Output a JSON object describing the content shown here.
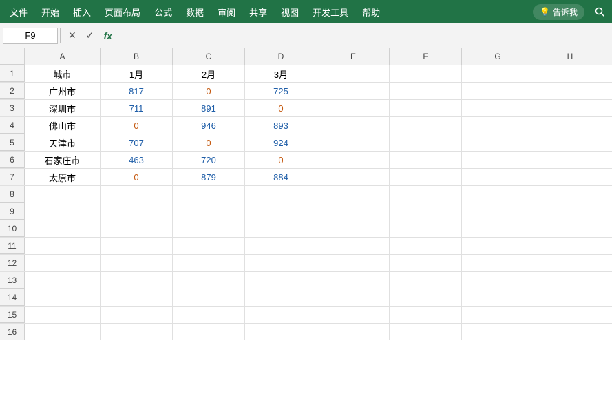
{
  "menubar": {
    "items": [
      "文件",
      "开始",
      "插入",
      "页面布局",
      "公式",
      "数据",
      "审阅",
      "共享",
      "视图",
      "开发工具",
      "帮助"
    ],
    "tell_me": "告诉我",
    "tell_me_placeholder": "告诉我..."
  },
  "formulabar": {
    "cell_ref": "F9",
    "cancel_icon": "✕",
    "confirm_icon": "✓",
    "fx_label": "fx"
  },
  "columns": {
    "corner": "",
    "headers": [
      "A",
      "B",
      "C",
      "D",
      "E",
      "F",
      "G",
      "H"
    ]
  },
  "rows": [
    {
      "num": "1",
      "cells": [
        {
          "value": "城市",
          "color": "black",
          "align": "center"
        },
        {
          "value": "1月",
          "color": "black",
          "align": "center"
        },
        {
          "value": "2月",
          "color": "black",
          "align": "center"
        },
        {
          "value": "3月",
          "color": "black",
          "align": "center"
        },
        {
          "value": "",
          "color": "black",
          "align": "center"
        },
        {
          "value": "",
          "color": "black",
          "align": "center"
        },
        {
          "value": "",
          "color": "black",
          "align": "center"
        },
        {
          "value": "",
          "color": "black",
          "align": "center"
        }
      ]
    },
    {
      "num": "2",
      "cells": [
        {
          "value": "广州市",
          "color": "black",
          "align": "center"
        },
        {
          "value": "817",
          "color": "blue",
          "align": "center"
        },
        {
          "value": "0",
          "color": "orange",
          "align": "center"
        },
        {
          "value": "725",
          "color": "blue",
          "align": "center"
        },
        {
          "value": "",
          "color": "black",
          "align": "center"
        },
        {
          "value": "",
          "color": "black",
          "align": "center"
        },
        {
          "value": "",
          "color": "black",
          "align": "center"
        },
        {
          "value": "",
          "color": "black",
          "align": "center"
        }
      ]
    },
    {
      "num": "3",
      "cells": [
        {
          "value": "深圳市",
          "color": "black",
          "align": "center"
        },
        {
          "value": "711",
          "color": "blue",
          "align": "center"
        },
        {
          "value": "891",
          "color": "blue",
          "align": "center"
        },
        {
          "value": "0",
          "color": "orange",
          "align": "center"
        },
        {
          "value": "",
          "color": "black",
          "align": "center"
        },
        {
          "value": "",
          "color": "black",
          "align": "center"
        },
        {
          "value": "",
          "color": "black",
          "align": "center"
        },
        {
          "value": "",
          "color": "black",
          "align": "center"
        }
      ]
    },
    {
      "num": "4",
      "cells": [
        {
          "value": "佛山市",
          "color": "black",
          "align": "center"
        },
        {
          "value": "0",
          "color": "orange",
          "align": "center"
        },
        {
          "value": "946",
          "color": "blue",
          "align": "center"
        },
        {
          "value": "893",
          "color": "blue",
          "align": "center"
        },
        {
          "value": "",
          "color": "black",
          "align": "center"
        },
        {
          "value": "",
          "color": "black",
          "align": "center"
        },
        {
          "value": "",
          "color": "black",
          "align": "center"
        },
        {
          "value": "",
          "color": "black",
          "align": "center"
        }
      ]
    },
    {
      "num": "5",
      "cells": [
        {
          "value": "天津市",
          "color": "black",
          "align": "center"
        },
        {
          "value": "707",
          "color": "blue",
          "align": "center"
        },
        {
          "value": "0",
          "color": "orange",
          "align": "center"
        },
        {
          "value": "924",
          "color": "blue",
          "align": "center"
        },
        {
          "value": "",
          "color": "black",
          "align": "center"
        },
        {
          "value": "",
          "color": "black",
          "align": "center"
        },
        {
          "value": "",
          "color": "black",
          "align": "center"
        },
        {
          "value": "",
          "color": "black",
          "align": "center"
        }
      ]
    },
    {
      "num": "6",
      "cells": [
        {
          "value": "石家庄市",
          "color": "black",
          "align": "center"
        },
        {
          "value": "463",
          "color": "blue",
          "align": "center"
        },
        {
          "value": "720",
          "color": "blue",
          "align": "center"
        },
        {
          "value": "0",
          "color": "orange",
          "align": "center"
        },
        {
          "value": "",
          "color": "black",
          "align": "center"
        },
        {
          "value": "",
          "color": "black",
          "align": "center"
        },
        {
          "value": "",
          "color": "black",
          "align": "center"
        },
        {
          "value": "",
          "color": "black",
          "align": "center"
        }
      ]
    },
    {
      "num": "7",
      "cells": [
        {
          "value": "太原市",
          "color": "black",
          "align": "center"
        },
        {
          "value": "0",
          "color": "orange",
          "align": "center"
        },
        {
          "value": "879",
          "color": "blue",
          "align": "center"
        },
        {
          "value": "884",
          "color": "blue",
          "align": "center"
        },
        {
          "value": "",
          "color": "black",
          "align": "center"
        },
        {
          "value": "",
          "color": "black",
          "align": "center"
        },
        {
          "value": "",
          "color": "black",
          "align": "center"
        },
        {
          "value": "",
          "color": "black",
          "align": "center"
        }
      ]
    },
    {
      "num": "8",
      "cells": [
        {
          "value": ""
        },
        {
          "value": ""
        },
        {
          "value": ""
        },
        {
          "value": ""
        },
        {
          "value": ""
        },
        {
          "value": ""
        },
        {
          "value": ""
        },
        {
          "value": ""
        }
      ]
    },
    {
      "num": "9",
      "cells": [
        {
          "value": ""
        },
        {
          "value": ""
        },
        {
          "value": ""
        },
        {
          "value": ""
        },
        {
          "value": ""
        },
        {
          "value": ""
        },
        {
          "value": ""
        },
        {
          "value": ""
        }
      ]
    },
    {
      "num": "10",
      "cells": [
        {
          "value": ""
        },
        {
          "value": ""
        },
        {
          "value": ""
        },
        {
          "value": ""
        },
        {
          "value": ""
        },
        {
          "value": ""
        },
        {
          "value": ""
        },
        {
          "value": ""
        }
      ]
    },
    {
      "num": "11",
      "cells": [
        {
          "value": ""
        },
        {
          "value": ""
        },
        {
          "value": ""
        },
        {
          "value": ""
        },
        {
          "value": ""
        },
        {
          "value": ""
        },
        {
          "value": ""
        },
        {
          "value": ""
        }
      ]
    },
    {
      "num": "12",
      "cells": [
        {
          "value": ""
        },
        {
          "value": ""
        },
        {
          "value": ""
        },
        {
          "value": ""
        },
        {
          "value": ""
        },
        {
          "value": ""
        },
        {
          "value": ""
        },
        {
          "value": ""
        }
      ]
    },
    {
      "num": "13",
      "cells": [
        {
          "value": ""
        },
        {
          "value": ""
        },
        {
          "value": ""
        },
        {
          "value": ""
        },
        {
          "value": ""
        },
        {
          "value": ""
        },
        {
          "value": ""
        },
        {
          "value": ""
        }
      ]
    },
    {
      "num": "14",
      "cells": [
        {
          "value": ""
        },
        {
          "value": ""
        },
        {
          "value": ""
        },
        {
          "value": ""
        },
        {
          "value": ""
        },
        {
          "value": ""
        },
        {
          "value": ""
        },
        {
          "value": ""
        }
      ]
    },
    {
      "num": "15",
      "cells": [
        {
          "value": ""
        },
        {
          "value": ""
        },
        {
          "value": ""
        },
        {
          "value": ""
        },
        {
          "value": ""
        },
        {
          "value": ""
        },
        {
          "value": ""
        },
        {
          "value": ""
        }
      ]
    },
    {
      "num": "16",
      "cells": [
        {
          "value": ""
        },
        {
          "value": ""
        },
        {
          "value": ""
        },
        {
          "value": ""
        },
        {
          "value": ""
        },
        {
          "value": ""
        },
        {
          "value": ""
        },
        {
          "value": ""
        }
      ]
    }
  ],
  "selected_cell": "F9",
  "colors": {
    "green": "#217346",
    "blue_cell": "#1f5ea8",
    "orange_cell": "#c55a11",
    "header_bg": "#f3f3f3",
    "border": "#d0d0d0"
  }
}
